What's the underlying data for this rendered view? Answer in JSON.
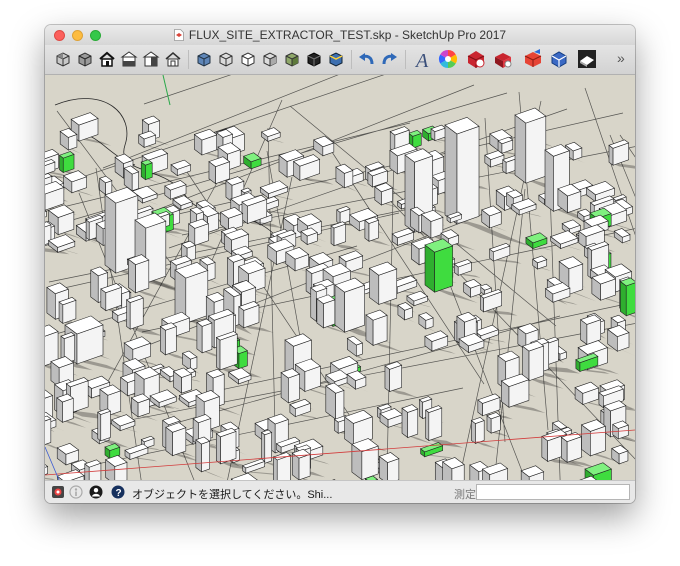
{
  "window": {
    "title": "FLUX_SITE_EXTRACTOR_TEST.skp - SketchUp Pro 2017"
  },
  "toolbar": {
    "tools": [
      "orbit-box-icon",
      "iso-view-icon",
      "top-view-icon",
      "front-view-icon",
      "right-view-icon",
      "back-view-icon",
      "left-view-icon",
      "xray-style-icon",
      "wireframe-style-icon",
      "hidden-line-style-icon",
      "shaded-style-icon",
      "shaded-textures-style-icon",
      "monochrome-style-icon",
      "back-edges-style-icon",
      "undo-icon",
      "redo-icon",
      "3d-text-icon",
      "paint-bucket-icon",
      "3d-warehouse-icon",
      "extension-warehouse-icon",
      "layout-send-icon",
      "components-icon",
      "styles-panel-icon"
    ],
    "overflow_label": "»"
  },
  "statusbar": {
    "message": "オブジェクトを選択してください。Shi...",
    "measure_label": "測定",
    "measure_value": ""
  },
  "colors": {
    "viewport_bg": "#d8d5c9",
    "building_green": "#3fdc3f",
    "axis_red": "#d23b3b",
    "axis_green": "#2aa84a",
    "axis_blue": "#3b5bd2"
  }
}
